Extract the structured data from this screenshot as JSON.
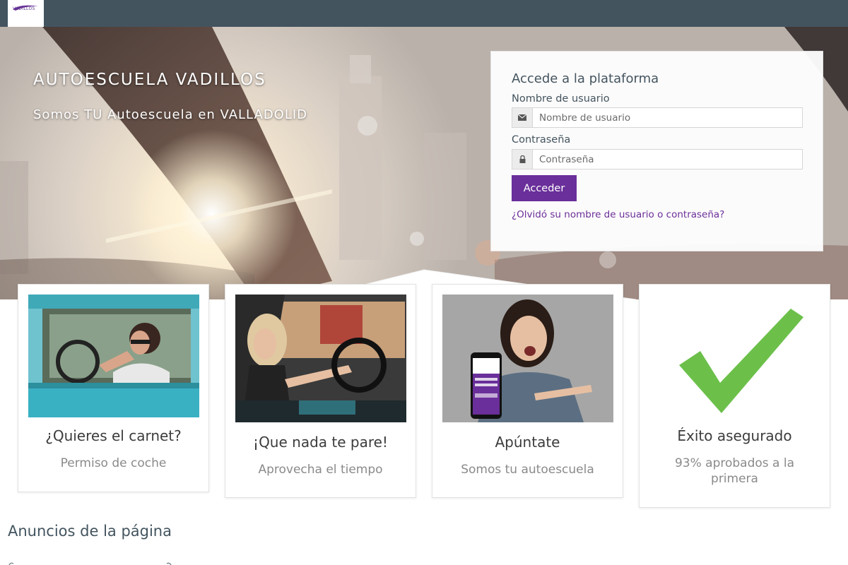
{
  "navbar": {
    "logo_text": "VADILLOS"
  },
  "hero": {
    "title": "AUTOESCUELA VADILLOS",
    "subtitle": "Somos TU Autoescuela en VALLADOLID"
  },
  "login": {
    "heading": "Accede a la plataforma",
    "username_label": "Nombre de usuario",
    "username_placeholder": "Nombre de usuario",
    "password_label": "Contraseña",
    "password_placeholder": "Contraseña",
    "submit_label": "Acceder",
    "forgot_link": "¿Olvidó su nombre de usuario o contraseña?"
  },
  "cards": [
    {
      "title": "¿Quieres el carnet?",
      "subtitle": "Permiso de coche"
    },
    {
      "title": "¡Que nada te pare!",
      "subtitle": "Aprovecha el tiempo"
    },
    {
      "title": "Apúntate",
      "subtitle": "Somos tu autoescuela"
    },
    {
      "title": "Éxito asegurado",
      "subtitle": "93% aprobados a la primera"
    }
  ],
  "announcements": {
    "title": "Anuncios de la página"
  },
  "colors": {
    "navbar": "#43545f",
    "accent": "#6a2f9a",
    "check": "#6cc04a"
  }
}
